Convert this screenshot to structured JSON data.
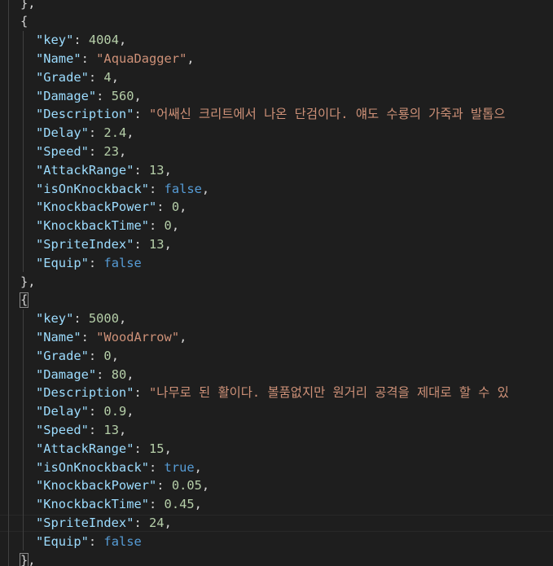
{
  "top_partial": "},",
  "objects": [
    {
      "open": "{",
      "close": "},",
      "fields": [
        {
          "key": "\"key\"",
          "value": "4004",
          "type": "n",
          "comma": ","
        },
        {
          "key": "\"Name\"",
          "value": "\"AquaDagger\"",
          "type": "s",
          "comma": ","
        },
        {
          "key": "\"Grade\"",
          "value": "4",
          "type": "n",
          "comma": ","
        },
        {
          "key": "\"Damage\"",
          "value": "560",
          "type": "n",
          "comma": ","
        },
        {
          "key": "\"Description\"",
          "value": "\"어쌔신 크리트에서 나온 단검이다. 얘도 수룡의 가죽과 발톱으",
          "type": "s",
          "comma": ""
        },
        {
          "key": "\"Delay\"",
          "value": "2.4",
          "type": "n",
          "comma": ","
        },
        {
          "key": "\"Speed\"",
          "value": "23",
          "type": "n",
          "comma": ","
        },
        {
          "key": "\"AttackRange\"",
          "value": "13",
          "type": "n",
          "comma": ","
        },
        {
          "key": "\"isOnKnockback\"",
          "value": "false",
          "type": "b",
          "comma": ","
        },
        {
          "key": "\"KnockbackPower\"",
          "value": "0",
          "type": "n",
          "comma": ","
        },
        {
          "key": "\"KnockbackTime\"",
          "value": "0",
          "type": "n",
          "comma": ","
        },
        {
          "key": "\"SpriteIndex\"",
          "value": "13",
          "type": "n",
          "comma": ","
        },
        {
          "key": "\"Equip\"",
          "value": "false",
          "type": "b",
          "comma": ""
        }
      ]
    },
    {
      "open": "{",
      "close": "},",
      "fields": [
        {
          "key": "\"key\"",
          "value": "5000",
          "type": "n",
          "comma": ","
        },
        {
          "key": "\"Name\"",
          "value": "\"WoodArrow\"",
          "type": "s",
          "comma": ","
        },
        {
          "key": "\"Grade\"",
          "value": "0",
          "type": "n",
          "comma": ","
        },
        {
          "key": "\"Damage\"",
          "value": "80",
          "type": "n",
          "comma": ","
        },
        {
          "key": "\"Description\"",
          "value": "\"나무로 된 활이다. 볼품없지만 원거리 공격을 제대로 할 수 있",
          "type": "s",
          "comma": ""
        },
        {
          "key": "\"Delay\"",
          "value": "0.9",
          "type": "n",
          "comma": ","
        },
        {
          "key": "\"Speed\"",
          "value": "13",
          "type": "n",
          "comma": ","
        },
        {
          "key": "\"AttackRange\"",
          "value": "15",
          "type": "n",
          "comma": ","
        },
        {
          "key": "\"isOnKnockback\"",
          "value": "true",
          "type": "b",
          "comma": ","
        },
        {
          "key": "\"KnockbackPower\"",
          "value": "0.05",
          "type": "n",
          "comma": ","
        },
        {
          "key": "\"KnockbackTime\"",
          "value": "0.45",
          "type": "n",
          "comma": ","
        },
        {
          "key": "\"SpriteIndex\"",
          "value": "24",
          "type": "n",
          "comma": ","
        },
        {
          "key": "\"Equip\"",
          "value": "false",
          "type": "b",
          "comma": ""
        }
      ]
    }
  ],
  "colors": {
    "background": "#1e1e1e",
    "key": "#9cdcfe",
    "string": "#ce9178",
    "number": "#b5cea8",
    "boolean": "#569cd6",
    "punctuation": "#d4d4d4"
  }
}
